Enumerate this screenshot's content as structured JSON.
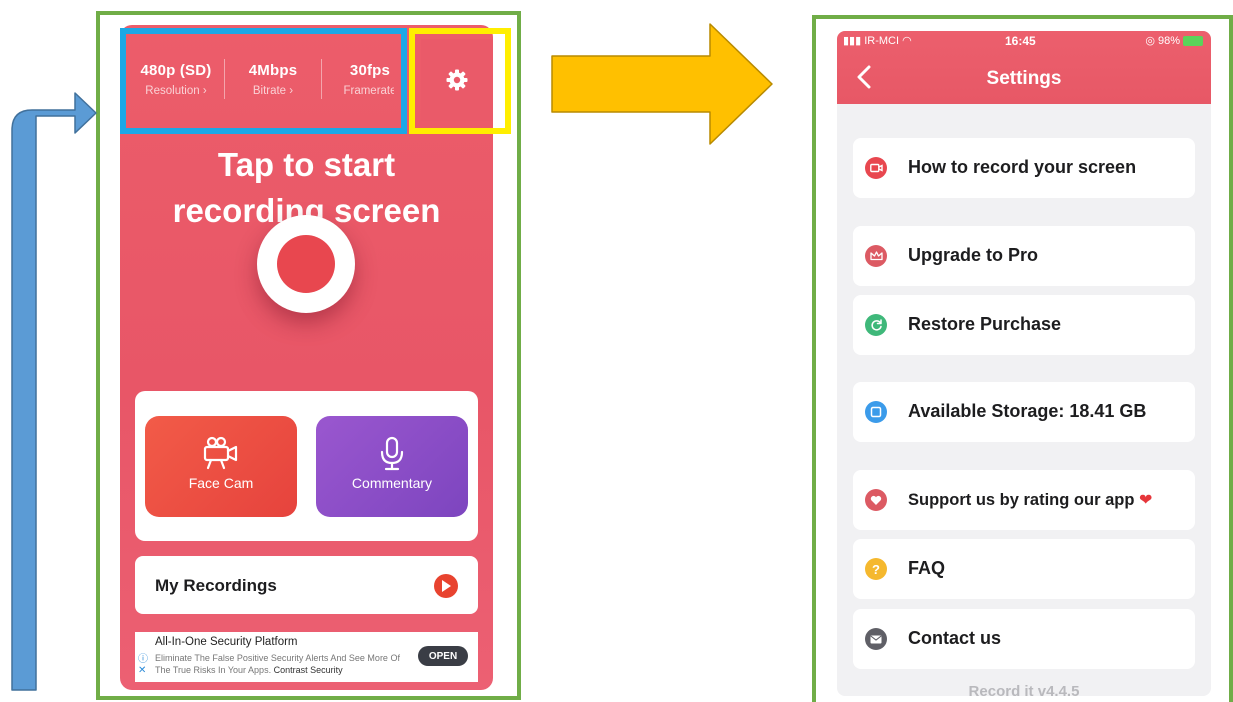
{
  "left_phone": {
    "stats": [
      {
        "value": "480p (SD)",
        "label": "Resolution"
      },
      {
        "value": "4Mbps",
        "label": "Bitrate"
      },
      {
        "value": "30fps",
        "label": "Framerate"
      }
    ],
    "headline_line1": "Tap to start",
    "headline_line2": "recording screen",
    "face_cam_label": "Face Cam",
    "commentary_label": "Commentary",
    "my_recordings_label": "My Recordings",
    "ad": {
      "title": "All-In-One Security Platform",
      "description": "Eliminate The False Positive Security Alerts And See More Of The True Risks In Your Apps.",
      "sponsor": "Contrast Security",
      "open_label": "OPEN"
    }
  },
  "right_phone": {
    "status_bar": {
      "carrier": "IR-MCI",
      "time": "16:45",
      "battery": "98%"
    },
    "title": "Settings",
    "rows": [
      {
        "label": "How to record your screen",
        "icon": "video-camera-icon",
        "color": "#e8474f"
      },
      {
        "label": "Upgrade to Pro",
        "icon": "crown-icon",
        "color": "#dc5a63"
      },
      {
        "label": "Restore Purchase",
        "icon": "refresh-icon",
        "color": "#3fb87a"
      },
      {
        "label": "Available Storage: 18.41 GB",
        "icon": "storage-icon",
        "color": "#3b9bea"
      },
      {
        "label": "Support us by rating our app",
        "icon": "heart-icon",
        "color": "#dc5a63"
      },
      {
        "label": "FAQ",
        "icon": "question-icon",
        "color": "#f5b82e"
      },
      {
        "label": "Contact us",
        "icon": "mail-icon",
        "color": "#5f5f66"
      }
    ],
    "version": "Record it v4.4.5"
  },
  "colors": {
    "app_red": "#e85667",
    "annotation_green": "#70ad47",
    "annotation_blue": "#1ca8e6",
    "annotation_yellow": "#ffee00",
    "arrow_orange": "#ffc000",
    "arrow_blue": "#5b9bd5"
  }
}
